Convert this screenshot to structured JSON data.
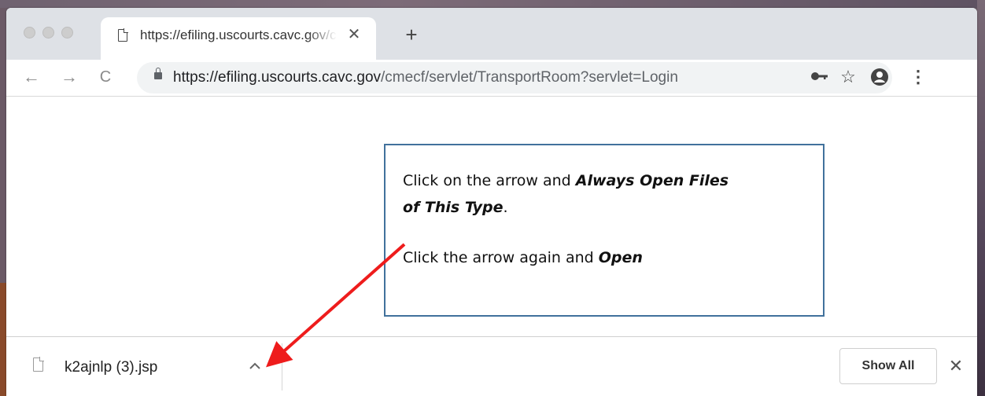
{
  "tab": {
    "title": "https://efiling.uscourts.cavc.gov/cmecf/servlet/TransportRoom?servlet=Login",
    "close": "✕",
    "new_tab": "+"
  },
  "toolbar": {
    "back": "←",
    "forward": "→",
    "reload": "C",
    "url_host": "https://efiling.uscourts.cavc.gov",
    "url_path": "/cmecf/servlet/TransportRoom?servlet=Login",
    "star": "☆",
    "menu": "⋮"
  },
  "callout": {
    "line1_prefix": "Click on the arrow and ",
    "line1_bold": "Always Open Files",
    "line2_bold": "of This Type",
    "line2_suffix": ".",
    "line3_prefix": "Click the arrow again and ",
    "line3_bold": "Open"
  },
  "download_bar": {
    "file_name": "k2ajnlp (3).jsp",
    "show_all": "Show All",
    "close": "✕"
  },
  "colors": {
    "arrow": "#ee1c1c",
    "callout_border": "#41719c",
    "tabstrip": "#dee1e6",
    "omnibox": "#f1f3f4"
  },
  "icons": [
    "document-icon",
    "lock-icon",
    "key-icon",
    "star-icon",
    "account-icon",
    "menu-icon",
    "chevron-up-icon",
    "file-icon",
    "close-icon"
  ]
}
